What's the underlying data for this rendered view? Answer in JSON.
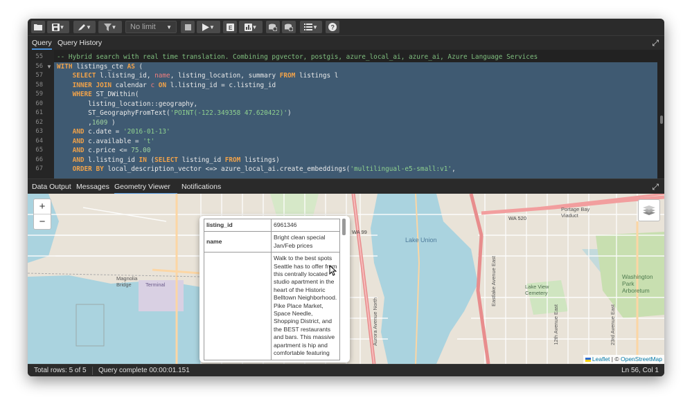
{
  "toolbar": {
    "limit_select": "No limit"
  },
  "query_tabs": [
    "Query",
    "Query History"
  ],
  "editor": {
    "lines": [
      {
        "n": "55",
        "html": "<span class='cm'>-- Hybrid search with real time translation. Combining pgvector, postgis, azure_local_ai, azure_ai, Azure Language Services</span>"
      },
      {
        "n": "56",
        "html": "<span class='kw'>WITH</span> listings_cte <span class='kw'>AS</span> ("
      },
      {
        "n": "57",
        "html": "    <span class='kw'>SELECT</span> l.listing_id, <span class='ty'>name</span>, listing_location, summary <span class='kw'>FROM</span> listings l"
      },
      {
        "n": "58",
        "html": "    <span class='kw'>INNER JOIN</span> calendar <span class='ty'>c</span> <span class='kw'>ON</span> l.listing_id = c.listing_id"
      },
      {
        "n": "59",
        "html": "    <span class='kw'>WHERE</span> ST_DWithin("
      },
      {
        "n": "60",
        "html": "        listing_location::geography,"
      },
      {
        "n": "61",
        "html": "        ST_GeographyFromText(<span class='str'>'POINT(-122.349358 47.620422)'</span>)"
      },
      {
        "n": "62",
        "html": "        ,<span class='num'>1609</span> )"
      },
      {
        "n": "63",
        "html": "    <span class='kw'>AND</span> c.date = <span class='str'>'2016-01-13'</span>"
      },
      {
        "n": "64",
        "html": "    <span class='kw'>AND</span> c.available = <span class='str'>'t'</span>"
      },
      {
        "n": "65",
        "html": "    <span class='kw'>AND</span> c.price &lt;= <span class='num'>75.00</span>"
      },
      {
        "n": "66",
        "html": "    <span class='kw'>AND</span> l.listing_id <span class='kw'>IN</span> (<span class='kw'>SELECT</span> listing_id <span class='kw'>FROM</span> listings)"
      },
      {
        "n": "67",
        "html": "    <span class='kw'>ORDER BY</span> local_description_vector &lt;=&gt; azure_local_ai.create_embeddings(<span class='str'>'multilingual-e5-small:v1'</span>,"
      }
    ]
  },
  "result_tabs": [
    "Data Output",
    "Messages",
    "Geometry Viewer",
    "Notifications"
  ],
  "map": {
    "zoom_in": "+",
    "zoom_out": "−",
    "labels": [
      "Lake Union",
      "Magnolia Bridge",
      "Terminal",
      "Portage Bay Viaduct",
      "WA 520",
      "WA 99",
      "Lake View Cemetery",
      "Washington Park Arboretum",
      "Aurora Avenue North",
      "Eastlake Avenue East",
      "23rd Avenue East",
      "12th Avenue East"
    ],
    "attribution_leaflet": "Leaflet",
    "attribution_sep": " | © ",
    "attribution_osm": "OpenStreetMap"
  },
  "popup": {
    "rows": [
      {
        "key": "listing_id",
        "value": "6961346"
      },
      {
        "key": "name",
        "value": "Bright clean special Jan/Feb prices"
      },
      {
        "key": "",
        "value": "Walk to the best spots Seattle has to offer from this centrally located studio apartment in the heart of the Historic Belltown Neighborhood. Pike Place Market, Space Needle, Shopping District, and the BEST restaurants and bars. This massive apartment is hip and comfortable featuring"
      }
    ]
  },
  "status": {
    "total_rows": "Total rows: 5 of 5",
    "query_complete": "Query complete 00:00:01.151",
    "cursor": "Ln 56, Col 1"
  },
  "colors": {
    "accent": "#4a90d9",
    "selection": "#3f5a72",
    "keyword": "#f0a24a",
    "string": "#8fd18f",
    "comment": "#7fbf7f"
  }
}
